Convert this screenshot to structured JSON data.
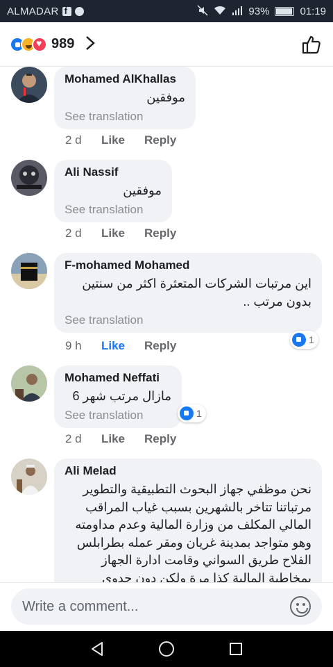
{
  "status_bar": {
    "carrier": "ALMADAR",
    "battery": "93%",
    "battery_level": 0.93,
    "time": "01:19"
  },
  "header": {
    "reaction_icons": [
      "like-icon",
      "haha-icon",
      "love-icon"
    ],
    "reaction_count": "989"
  },
  "comments": [
    {
      "author": "Mohamed AlKhallas",
      "text": "موفقين",
      "translation": "See translation",
      "time": "2 d",
      "like": "Like",
      "reply": "Reply",
      "liked": false,
      "reaction_count": ""
    },
    {
      "author": "Ali Nassif",
      "text": "موفقين",
      "translation": "See translation",
      "time": "2 d",
      "like": "Like",
      "reply": "Reply",
      "liked": false,
      "reaction_count": ""
    },
    {
      "author": "F-mohamed Mohamed",
      "text": "اين مرتبات الشركات المتعثرة اكثر من سنتين بدون مرتب ..",
      "translation": "See translation",
      "time": "9 h",
      "like": "Like",
      "reply": "Reply",
      "liked": true,
      "reaction_count": "1"
    },
    {
      "author": "Mohamed Neffati",
      "text": "مازال مرتب شهر 6",
      "translation": "See translation",
      "time": "2 d",
      "like": "Like",
      "reply": "Reply",
      "liked": false,
      "reaction_count": "1"
    },
    {
      "author": "Ali Melad",
      "text": "نحن موظفي جهاز البحوث التطبيقية والتطوير مرتباتنا تتاخر بالشهرين بسبب غياب المراقب المالي المكلف من وزارة المالية وعدم مداومته وهو متواجد بمدينة غريان ومقر عمله بطرابلس الفلاح طريق السواني وقامت ادارة الجهاز بمخاطبة المالية كذا مرة ولكن دون جدوى"
    }
  ],
  "composer": {
    "placeholder": "Write a comment..."
  },
  "colors": {
    "accent": "#1877f2",
    "bubble": "#f0f2f5",
    "status_bar": "#1e2430"
  }
}
